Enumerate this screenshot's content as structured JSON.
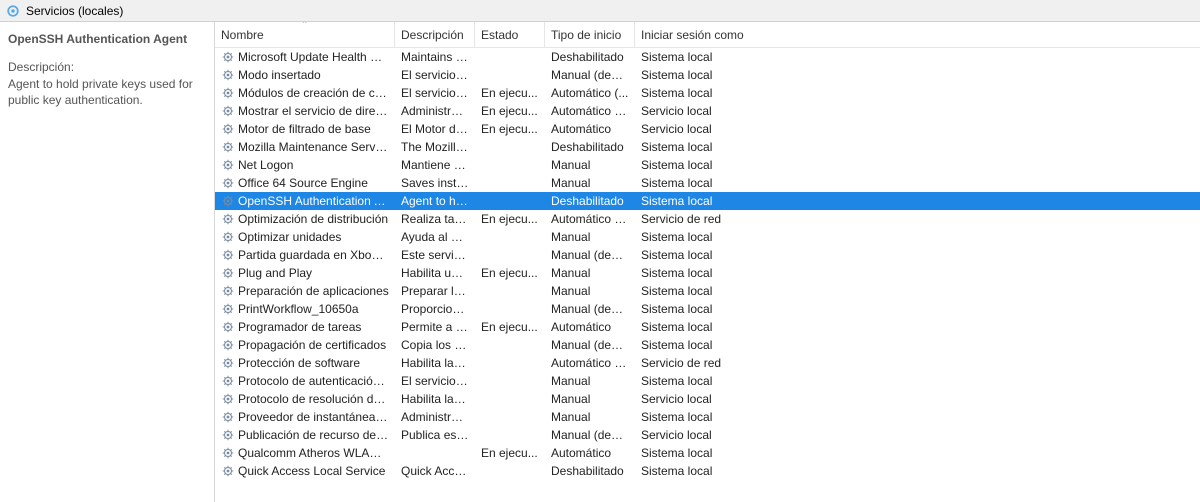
{
  "titlebar": {
    "title": "Servicios (locales)"
  },
  "sidebar": {
    "heading": "OpenSSH Authentication Agent",
    "desc_label": "Descripción:",
    "desc_text": "Agent to hold private keys used for public key authentication."
  },
  "columns": {
    "name": "Nombre",
    "desc": "Descripción",
    "status": "Estado",
    "startup": "Tipo de inicio",
    "logon": "Iniciar sesión como"
  },
  "services": [
    {
      "name": "Microsoft Update Health Se...",
      "desc": "Maintains U...",
      "status": "",
      "startup": "Deshabilitado",
      "logon": "Sistema local",
      "selected": false
    },
    {
      "name": "Modo insertado",
      "desc": "El servicio d...",
      "status": "",
      "startup": "Manual (dese...",
      "logon": "Sistema local",
      "selected": false
    },
    {
      "name": "Módulos de creación de cla...",
      "desc": "El servicio IK...",
      "status": "En ejecu...",
      "startup": "Automático (...",
      "logon": "Sistema local",
      "selected": false
    },
    {
      "name": "Mostrar el servicio de direct...",
      "desc": "Administra l...",
      "status": "En ejecu...",
      "startup": "Automático (i...",
      "logon": "Servicio local",
      "selected": false
    },
    {
      "name": "Motor de filtrado de base",
      "desc": "El Motor de ...",
      "status": "En ejecu...",
      "startup": "Automático",
      "logon": "Servicio local",
      "selected": false
    },
    {
      "name": "Mozilla Maintenance Service",
      "desc": "The Mozilla ...",
      "status": "",
      "startup": "Deshabilitado",
      "logon": "Sistema local",
      "selected": false
    },
    {
      "name": "Net Logon",
      "desc": "Mantiene u...",
      "status": "",
      "startup": "Manual",
      "logon": "Sistema local",
      "selected": false
    },
    {
      "name": "Office 64 Source Engine",
      "desc": "Saves install...",
      "status": "",
      "startup": "Manual",
      "logon": "Sistema local",
      "selected": false
    },
    {
      "name": "OpenSSH Authentication A...",
      "desc": "Agent to hol...",
      "status": "",
      "startup": "Deshabilitado",
      "logon": "Sistema local",
      "selected": true
    },
    {
      "name": "Optimización de distribución",
      "desc": "Realiza tarea...",
      "status": "En ejecu...",
      "startup": "Automático (i...",
      "logon": "Servicio de red",
      "selected": false
    },
    {
      "name": "Optimizar unidades",
      "desc": "Ayuda al eq...",
      "status": "",
      "startup": "Manual",
      "logon": "Sistema local",
      "selected": false
    },
    {
      "name": "Partida guardada en Xbox L...",
      "desc": "Este servicio...",
      "status": "",
      "startup": "Manual (dese...",
      "logon": "Sistema local",
      "selected": false
    },
    {
      "name": "Plug and Play",
      "desc": "Habilita un ...",
      "status": "En ejecu...",
      "startup": "Manual",
      "logon": "Sistema local",
      "selected": false
    },
    {
      "name": "Preparación de aplicaciones",
      "desc": "Preparar las ...",
      "status": "",
      "startup": "Manual",
      "logon": "Sistema local",
      "selected": false
    },
    {
      "name": "PrintWorkflow_10650a",
      "desc": "Proporciona...",
      "status": "",
      "startup": "Manual (dese...",
      "logon": "Sistema local",
      "selected": false
    },
    {
      "name": "Programador de tareas",
      "desc": "Permite a u...",
      "status": "En ejecu...",
      "startup": "Automático",
      "logon": "Sistema local",
      "selected": false
    },
    {
      "name": "Propagación de certificados",
      "desc": "Copia los ce...",
      "status": "",
      "startup": "Manual (dese...",
      "logon": "Sistema local",
      "selected": false
    },
    {
      "name": "Protección de software",
      "desc": "Habilita la d...",
      "status": "",
      "startup": "Automático (i...",
      "logon": "Servicio de red",
      "selected": false
    },
    {
      "name": "Protocolo de autenticación ...",
      "desc": "El servicio Pr...",
      "status": "",
      "startup": "Manual",
      "logon": "Sistema local",
      "selected": false
    },
    {
      "name": "Protocolo de resolución de ...",
      "desc": "Habilita la re...",
      "status": "",
      "startup": "Manual",
      "logon": "Servicio local",
      "selected": false
    },
    {
      "name": "Proveedor de instantáneas ...",
      "desc": "Administra i...",
      "status": "",
      "startup": "Manual",
      "logon": "Sistema local",
      "selected": false
    },
    {
      "name": "Publicación de recurso de d...",
      "desc": "Publica este ...",
      "status": "",
      "startup": "Manual (dese...",
      "logon": "Servicio local",
      "selected": false
    },
    {
      "name": "Qualcomm Atheros WLAN ...",
      "desc": "",
      "status": "En ejecu...",
      "startup": "Automático",
      "logon": "Sistema local",
      "selected": false
    },
    {
      "name": "Quick Access Local Service",
      "desc": "Quick Acces...",
      "status": "",
      "startup": "Deshabilitado",
      "logon": "Sistema local",
      "selected": false
    }
  ]
}
